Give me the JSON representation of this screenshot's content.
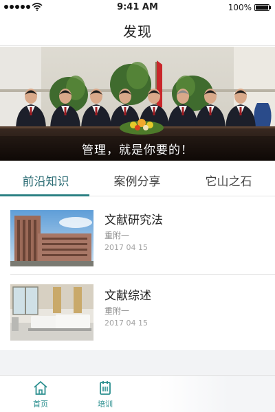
{
  "status_bar": {
    "time": "9:41 AM",
    "battery": "100%",
    "battery_level": 1.0,
    "signal_icon": "signal-dots-icon",
    "wifi_icon": "wifi-icon"
  },
  "nav": {
    "title": "发现"
  },
  "banner": {
    "caption": "管理，就是你要的！"
  },
  "tabs": [
    {
      "label": "前沿知识",
      "active": true
    },
    {
      "label": "案例分享",
      "active": false
    },
    {
      "label": "它山之石",
      "active": false
    }
  ],
  "articles": [
    {
      "title": "文献研究法",
      "author": "重附一",
      "date": "2017 04 15"
    },
    {
      "title": "文献综述",
      "author": "重附一",
      "date": "2017 04 15"
    }
  ],
  "tab_bar": {
    "items": [
      {
        "label": "首页",
        "icon": "home-icon"
      },
      {
        "label": "培训",
        "icon": "training-icon"
      }
    ]
  },
  "colors": {
    "accent": "#2a7f82",
    "tab_active_text": "#2a6b73",
    "tab_bar_label": "#2b8f8f"
  }
}
